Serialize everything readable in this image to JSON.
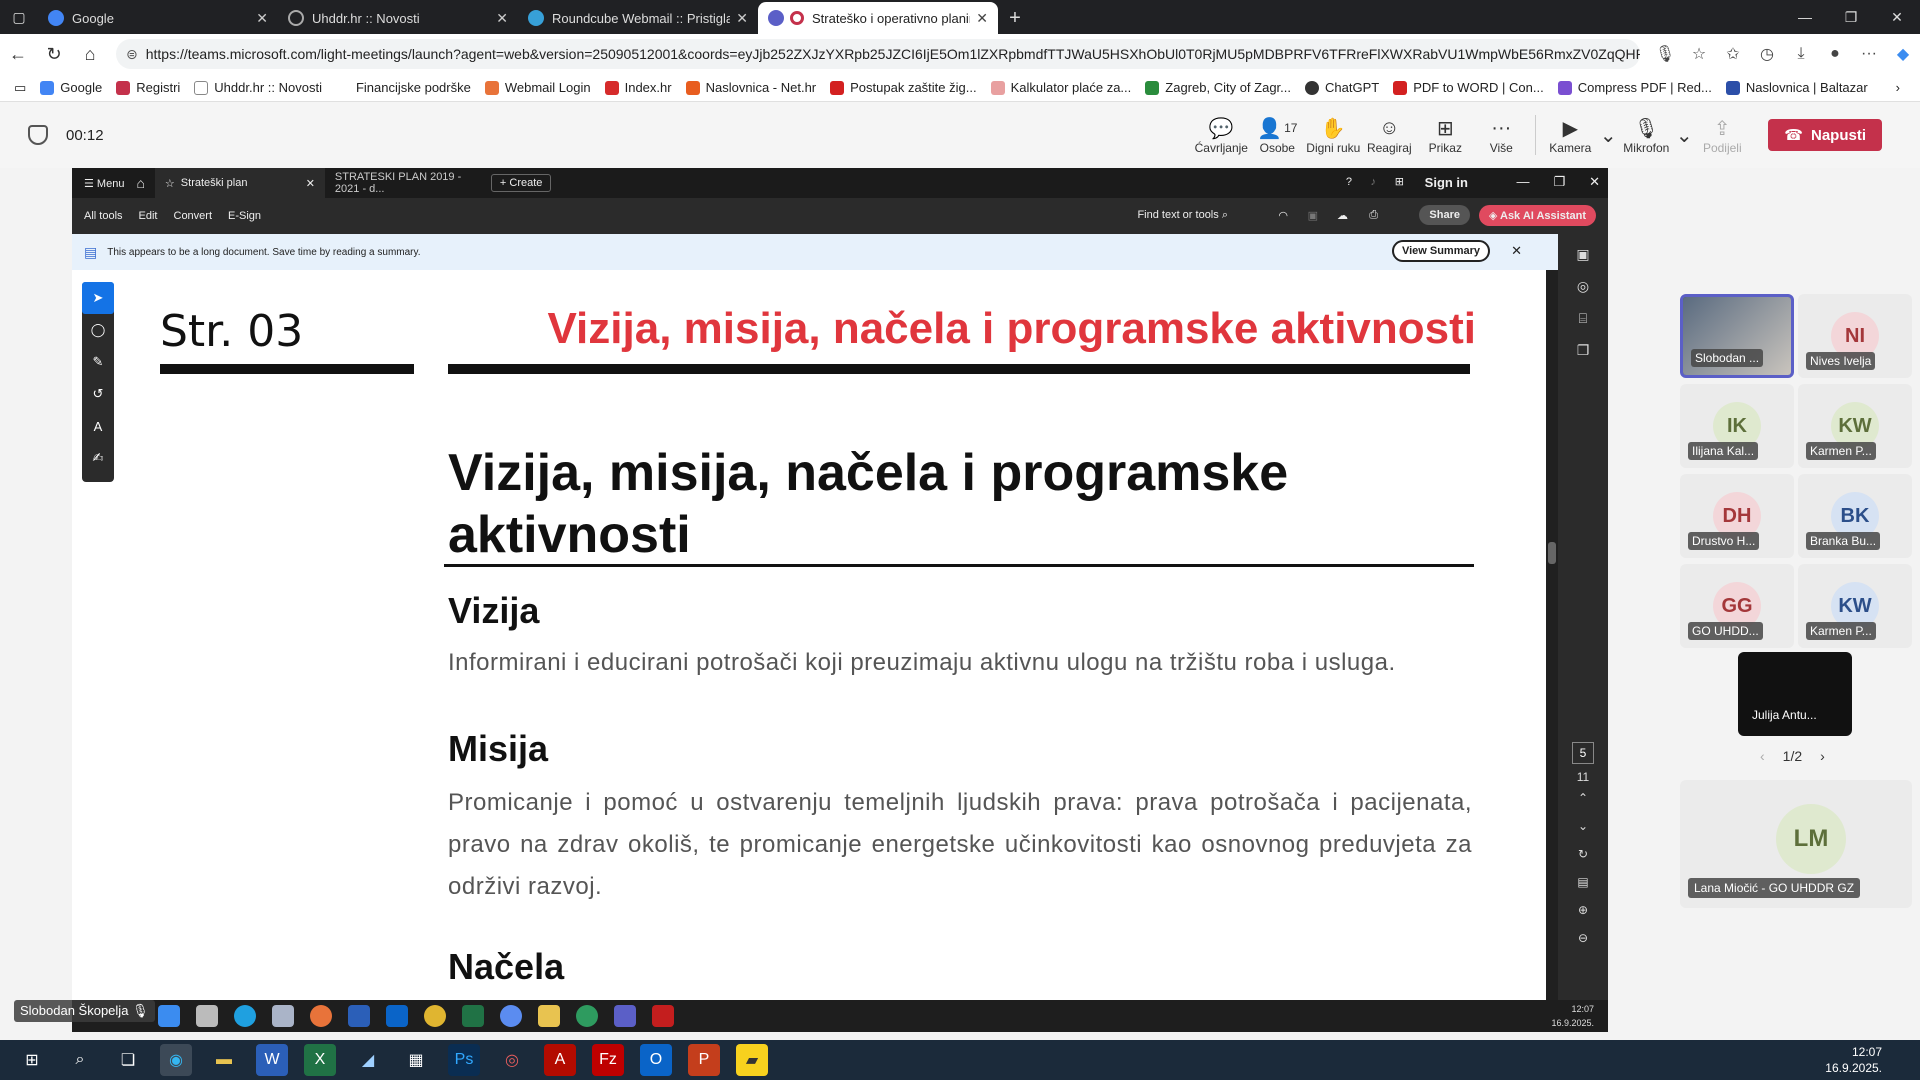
{
  "browser": {
    "tabs": [
      {
        "title": "Google",
        "color": "#4285f4"
      },
      {
        "title": "Uhddr.hr :: Novosti",
        "color": "#888888"
      },
      {
        "title": "Roundcube Webmail :: Pristigla pošta",
        "color": "#37a0d8"
      },
      {
        "title": "Strateško i operativno planiranje",
        "color": "#c4314b"
      }
    ],
    "new_tab": "+",
    "url": "https://teams.microsoft.com/light-meetings/launch?agent=web&version=25090512001&coords=eyJjb252ZXJzYXRpb25JZCI6IjE5Om1lZXRpbmdfTTJWaU5HSXhObUl0T0RjMU5pMDBPRFV6TFRreFlXWXRabVU1WmpWbE56RmxZV0ZqQHR..."
  },
  "bookmarks": [
    {
      "label": "Google",
      "color": "#4285f4"
    },
    {
      "label": "Registri",
      "color": "#c4314b"
    },
    {
      "label": "Uhddr.hr :: Novosti",
      "color": "#888888"
    },
    {
      "label": "Financijske podrške",
      "color": "#ffffff"
    },
    {
      "label": "Webmail Login",
      "color": "#e8733a"
    },
    {
      "label": "Index.hr",
      "color": "#d62b2b"
    },
    {
      "label": "Naslovnica - Net.hr",
      "color": "#e85d1f"
    },
    {
      "label": "Postupak zaštite žig...",
      "color": "#d32020"
    },
    {
      "label": "Kalkulator plaće za...",
      "color": "#e8a0a0"
    },
    {
      "label": "Zagreb, City of Zagr...",
      "color": "#2a8c3c"
    },
    {
      "label": "ChatGPT",
      "color": "#333333"
    },
    {
      "label": "PDF to WORD | Con...",
      "color": "#d32020"
    },
    {
      "label": "Compress PDF | Red...",
      "color": "#7a4fd1"
    },
    {
      "label": "Naslovnica | Baltazar",
      "color": "#2c4fa8"
    }
  ],
  "teams": {
    "timer": "00:12",
    "controls": [
      {
        "label": "Ćavrljanje",
        "icon": "💬"
      },
      {
        "label": "Osobe",
        "icon": "👤",
        "count": "17"
      },
      {
        "label": "Digni ruku",
        "icon": "✋"
      },
      {
        "label": "Reagiraj",
        "icon": "☺"
      },
      {
        "label": "Prikaz",
        "icon": "⊞"
      },
      {
        "label": "Više",
        "icon": "···"
      }
    ],
    "media": [
      {
        "label": "Kamera",
        "icon": "▶"
      },
      {
        "label": "Mikrofon",
        "icon": "🎙"
      },
      {
        "label": "Podijeli",
        "icon": "⇪"
      }
    ],
    "leave_label": "Napusti"
  },
  "acrobat": {
    "menu": "Menu",
    "tab1": "Strateški plan",
    "tab2": "STRATESKI PLAN 2019 - 2021 - d...",
    "create": "+ Create",
    "signin": "Sign in",
    "tools": [
      "All tools",
      "Edit",
      "Convert",
      "E-Sign"
    ],
    "find": "Find text or tools",
    "share": "Share",
    "ai": "Ask AI Assistant",
    "banner": "This appears to be a long document. Save time by reading a summary.",
    "view_summary": "View Summary",
    "page_num": "5",
    "page_total": "11"
  },
  "doc": {
    "str": "Str. 03",
    "red_title": "Vizija, misija, načela i programske aktivnosti",
    "h1": "Vizija, misija, načela i programske aktivnosti",
    "vizija_h": "Vizija",
    "vizija_p": "Informirani i educirani potrošači koji preuzimaju aktivnu ulogu na tržištu roba i usluga.",
    "misija_h": "Misija",
    "misija_p": "Promicanje i pomoć u ostvarenju temeljnih ljudskih prava: prava potrošača i pacijenata, pravo na zdrav okoliš, te promicanje energetske učinkovitosti kao osnovnog preduvjeta za održivi razvoj.",
    "nacela_h": "Načela"
  },
  "inner_clock": {
    "time": "12:07",
    "date": "16.9.2025."
  },
  "presenter": "Slobodan Škopelja",
  "participants": [
    {
      "initials": "",
      "name": "Slobodan ...",
      "bg": "#444444",
      "fg": "#ffffff"
    },
    {
      "initials": "NI",
      "name": "Nives Ivelja",
      "bg": "#f3d6d9",
      "fg": "#a4373a"
    },
    {
      "initials": "IK",
      "name": "Ilijana Kal...",
      "bg": "#dfe9cf",
      "fg": "#5d6f3a"
    },
    {
      "initials": "KW",
      "name": "Karmen P...",
      "bg": "#dfe9cf",
      "fg": "#5d6f3a"
    },
    {
      "initials": "DH",
      "name": "Drustvo H...",
      "bg": "#f3d6d9",
      "fg": "#a4373a"
    },
    {
      "initials": "BK",
      "name": "Branka Bu...",
      "bg": "#d6e2f3",
      "fg": "#2c4f8a"
    },
    {
      "initials": "GG",
      "name": "GO UHDD...",
      "bg": "#f3d6d9",
      "fg": "#a4373a"
    },
    {
      "initials": "KW",
      "name": "Karmen P...",
      "bg": "#d6e2f3",
      "fg": "#2c4f8a"
    },
    {
      "initials": "",
      "name": "Julija Antu...",
      "bg": "#111111",
      "fg": "#ffffff"
    }
  ],
  "pager": "1/2",
  "big_participant": {
    "initials": "LM",
    "name": "Lana Miočić - GO UHDDR GZ"
  },
  "windows_clock": {
    "time": "12:07",
    "date": "16.9.2025."
  }
}
